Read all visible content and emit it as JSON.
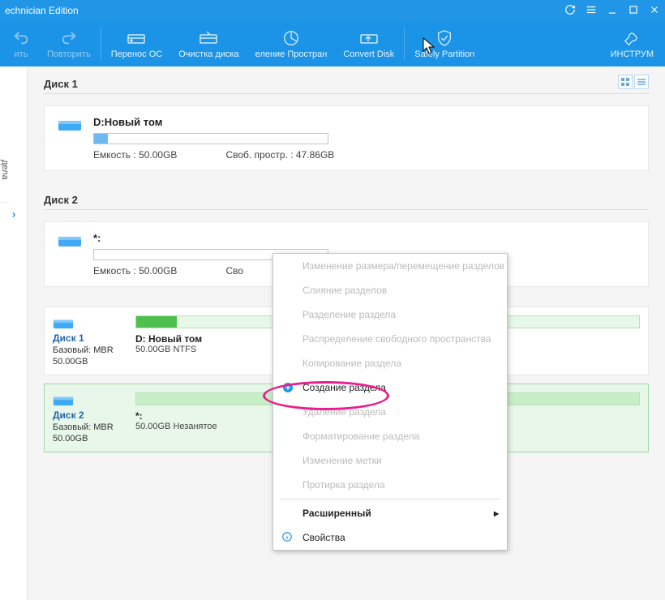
{
  "titlebar": {
    "title": "echnician Edition"
  },
  "toolbar": {
    "undo": "ить",
    "redo": "Повторить",
    "migrate": "Перенос ОС",
    "clean": "Очистка диска",
    "space": "еление Простран",
    "convert": "Convert Disk",
    "safely": "Safely Partition",
    "tools": "ИНСТРУМ"
  },
  "side": {
    "tab1": "",
    "tab2": "дела"
  },
  "disk1": {
    "label": "Диск 1",
    "vol_name": "D:Новый том",
    "capacity": "Емкость : 50.00GB",
    "free": "Своб. простр. : 47.86GB"
  },
  "disk2": {
    "label": "Диск 2",
    "vol_name": "*:",
    "capacity": "Емкость : 50.00GB",
    "free": "Сво"
  },
  "summary1": {
    "name": "Диск 1",
    "meta1": "Базовый: MBR",
    "meta2": "50.00GB",
    "bar_label": "D: Новый том",
    "bar_sub": "50.00GB NTFS"
  },
  "summary2": {
    "name": "Диск 2",
    "meta1": "Базовый: MBR",
    "meta2": "50.00GB",
    "bar_label": "*:",
    "bar_sub": "50.00GB Незанятое"
  },
  "ctx": {
    "resize": "Изменение размера/перемещение разделов",
    "merge": "Слияние разделов",
    "split": "Разделение раздела",
    "alloc": "Распределение свободного пространства",
    "copy": "Копирование раздела",
    "create": "Создание раздела",
    "delete": "Удаление раздела",
    "format": "Форматирование раздела",
    "label": "Изменение метки",
    "wipe": "Протирка раздела",
    "advanced": "Расширенный",
    "props": "Свойства"
  }
}
